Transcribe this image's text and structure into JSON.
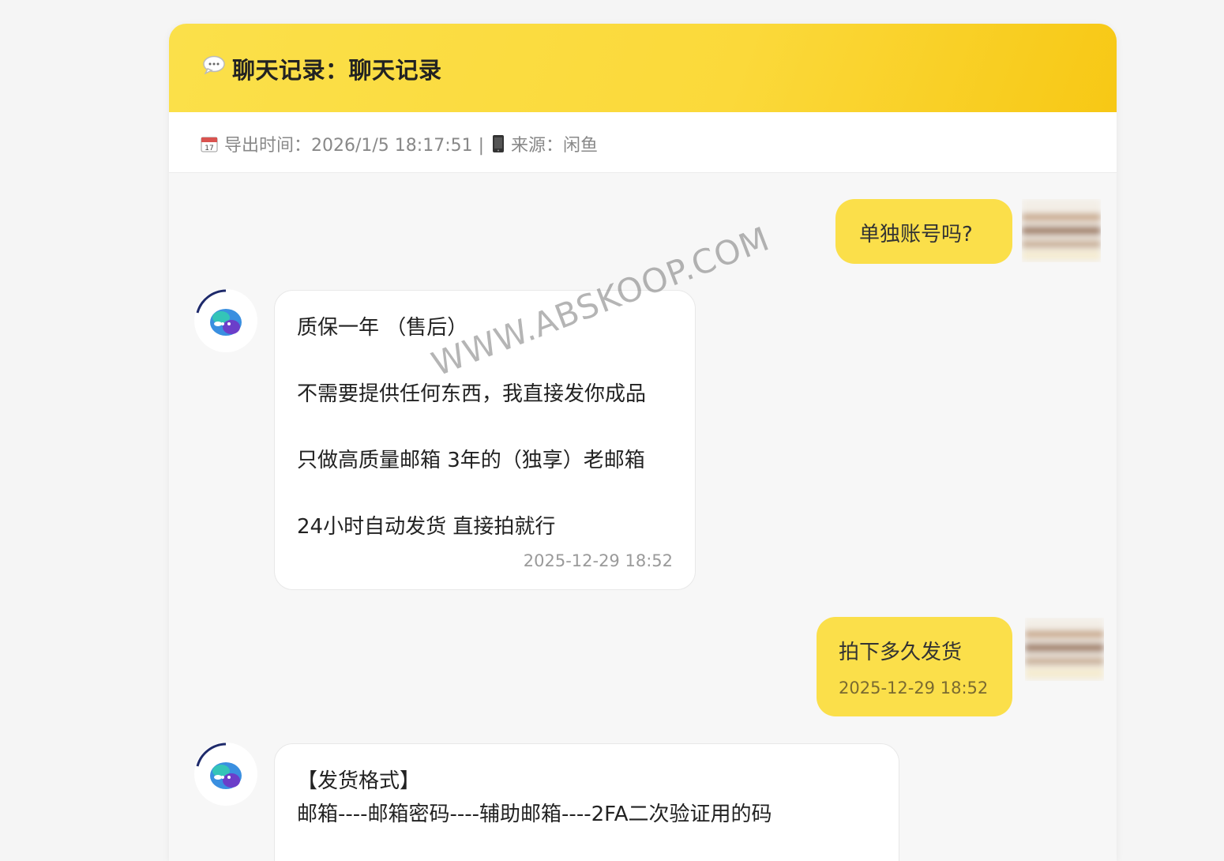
{
  "header": {
    "icon": "speech-bubble-icon",
    "title": "聊天记录：聊天记录"
  },
  "meta": {
    "calendar_icon": "calendar-icon",
    "export_label": "导出时间：2026/1/5 18:17:51 |",
    "phone_icon": "mobile-phone-icon",
    "source_label": "来源：闲鱼"
  },
  "messages": [
    {
      "side": "right",
      "lines": [
        "单独账号吗?"
      ]
    },
    {
      "side": "left",
      "lines": [
        "质保一年 （售后）",
        "不需要提供任何东西，我直接发你成品",
        "只做高质量邮箱 3年的（独享）老邮箱",
        "24小时自动发货 直接拍就行"
      ],
      "time": "2025-12-29 18:52"
    },
    {
      "side": "right",
      "lines": [
        "拍下多久发货"
      ],
      "time": "2025-12-29 18:52"
    },
    {
      "side": "left",
      "lines": [
        "【发货格式】",
        "邮箱----邮箱密码----辅助邮箱----2FA二次验证用的码"
      ]
    }
  ],
  "watermark": "WWW.ABSKOOP.COM",
  "colors": {
    "header_yellow": "#fbdc40",
    "bubble_yellow": "#fbdf4a",
    "background": "#f7f7f7"
  }
}
